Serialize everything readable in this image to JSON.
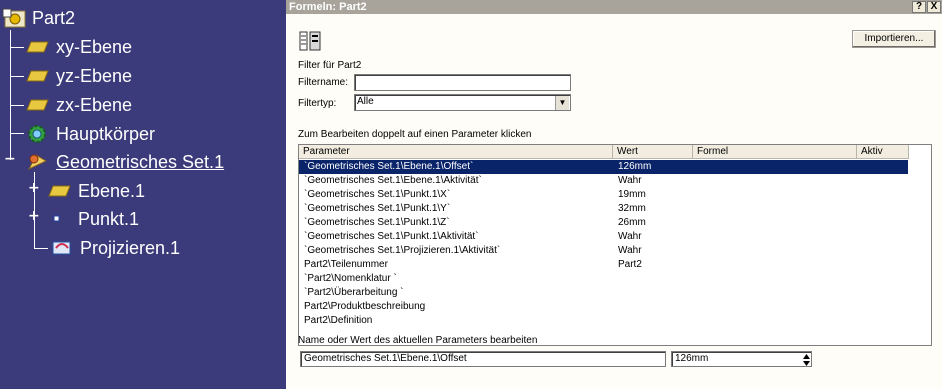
{
  "tree": {
    "root": "Part2",
    "items": [
      {
        "label": "xy-Ebene",
        "icon": "plane-icon"
      },
      {
        "label": "yz-Ebene",
        "icon": "plane-icon"
      },
      {
        "label": "zx-Ebene",
        "icon": "plane-icon"
      },
      {
        "label": "Hauptkörper",
        "icon": "gear-body-icon"
      },
      {
        "label": "Geometrisches Set.1",
        "icon": "geometrical-set-icon",
        "expanded": true
      },
      {
        "label": "Ebene.1",
        "icon": "plane-icon"
      },
      {
        "label": "Punkt.1",
        "icon": "point-icon"
      },
      {
        "label": "Projizieren.1",
        "icon": "projection-icon"
      }
    ]
  },
  "dialog": {
    "title": "Formeln: Part2",
    "help_label": "?",
    "close_label": "X",
    "import_label": "Importieren...",
    "filter_heading": "Filter für Part2",
    "filtername_label": "Filtername:",
    "filtername_value": "",
    "filtertype_label": "Filtertyp:",
    "filtertype_value": "Alle",
    "edit_hint": "Zum Bearbeiten doppelt auf einen Parameter klicken",
    "columns": [
      "Parameter",
      "Wert",
      "Formel",
      "Aktiv"
    ],
    "rows": [
      {
        "parameter": "`Geometrisches Set.1\\Ebene.1\\Offset`",
        "value": "126mm",
        "formula": "",
        "active": "",
        "selected": true
      },
      {
        "parameter": "`Geometrisches Set.1\\Ebene.1\\Aktivität`",
        "value": "Wahr",
        "formula": "",
        "active": ""
      },
      {
        "parameter": "`Geometrisches Set.1\\Punkt.1\\X`",
        "value": "19mm",
        "formula": "",
        "active": ""
      },
      {
        "parameter": "`Geometrisches Set.1\\Punkt.1\\Y`",
        "value": "32mm",
        "formula": "",
        "active": ""
      },
      {
        "parameter": "`Geometrisches Set.1\\Punkt.1\\Z`",
        "value": "26mm",
        "formula": "",
        "active": ""
      },
      {
        "parameter": "`Geometrisches Set.1\\Punkt.1\\Aktivität`",
        "value": "Wahr",
        "formula": "",
        "active": ""
      },
      {
        "parameter": "`Geometrisches Set.1\\Projizieren.1\\Aktivität`",
        "value": "Wahr",
        "formula": "",
        "active": ""
      },
      {
        "parameter": "Part2\\Teilenummer",
        "value": "Part2",
        "formula": "",
        "active": ""
      },
      {
        "parameter": "`Part2\\Nomenklatur `",
        "value": "",
        "formula": "",
        "active": ""
      },
      {
        "parameter": "`Part2\\Überarbeitung `",
        "value": "",
        "formula": "",
        "active": ""
      },
      {
        "parameter": "Part2\\Produktbeschreibung",
        "value": "",
        "formula": "",
        "active": ""
      },
      {
        "parameter": "Part2\\Definition",
        "value": "",
        "formula": "",
        "active": ""
      }
    ],
    "edit_label": "Name oder Wert des aktuellen Parameters bearbeiten",
    "edit_name_value": "Geometrisches Set.1\\Ebene.1\\Offset",
    "edit_value_value": "126mm"
  },
  "colors": {
    "tree_bg": "#3b3a7a",
    "dialog_bg": "#fffdf7",
    "selection": "#0a246a",
    "titlebar": "#a8a39b"
  }
}
